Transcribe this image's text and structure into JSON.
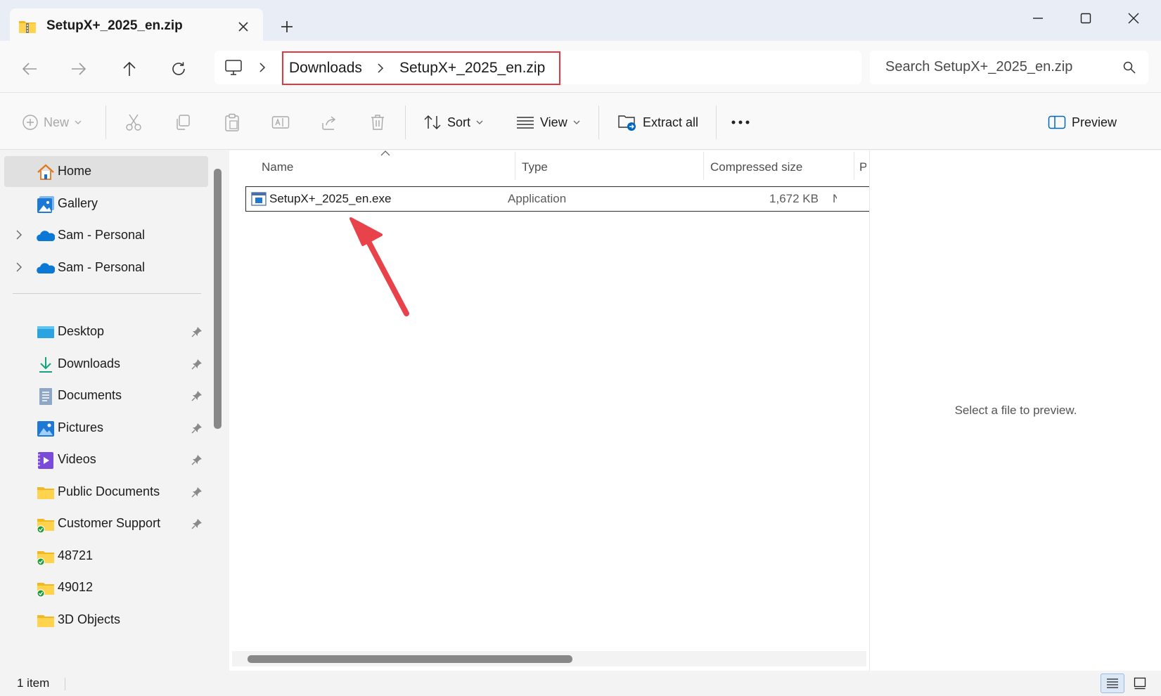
{
  "window": {
    "tab_title": "SetupX+_2025_en.zip"
  },
  "breadcrumb": {
    "items": [
      "Downloads",
      "SetupX+_2025_en.zip"
    ]
  },
  "search": {
    "placeholder": "Search SetupX+_2025_en.zip"
  },
  "toolbar": {
    "new_label": "New",
    "sort_label": "Sort",
    "view_label": "View",
    "extract_label": "Extract all",
    "preview_label": "Preview"
  },
  "sidebar": {
    "items": [
      {
        "label": "Home",
        "icon": "home-icon"
      },
      {
        "label": "Gallery",
        "icon": "gallery-icon"
      },
      {
        "label": "Sam - Personal",
        "icon": "onedrive-icon"
      },
      {
        "label": "Sam - Personal",
        "icon": "onedrive-icon"
      },
      {
        "label": "Desktop",
        "icon": "desktop-icon"
      },
      {
        "label": "Downloads",
        "icon": "download-icon"
      },
      {
        "label": "Documents",
        "icon": "documents-icon"
      },
      {
        "label": "Pictures",
        "icon": "pictures-icon"
      },
      {
        "label": "Videos",
        "icon": "videos-icon"
      },
      {
        "label": "Public Documents",
        "icon": "folder-icon"
      },
      {
        "label": "Customer Support",
        "icon": "folder-synced-icon"
      },
      {
        "label": "48721",
        "icon": "folder-synced-icon"
      },
      {
        "label": "49012",
        "icon": "folder-synced-icon"
      },
      {
        "label": "3D Objects",
        "icon": "folder-icon"
      }
    ]
  },
  "file_list": {
    "columns": [
      "Name",
      "Type",
      "Compressed size",
      "P"
    ],
    "rows": [
      {
        "name": "SetupX+_2025_en.exe",
        "type": "Application",
        "compressed_size": "1,672 KB",
        "extra": "N"
      }
    ]
  },
  "preview": {
    "message": "Select a file to preview."
  },
  "status": {
    "item_count": "1 item"
  },
  "colors": {
    "highlight_box": "#e5373e",
    "arrow": "#e8424a",
    "accent": "#0067c0"
  }
}
